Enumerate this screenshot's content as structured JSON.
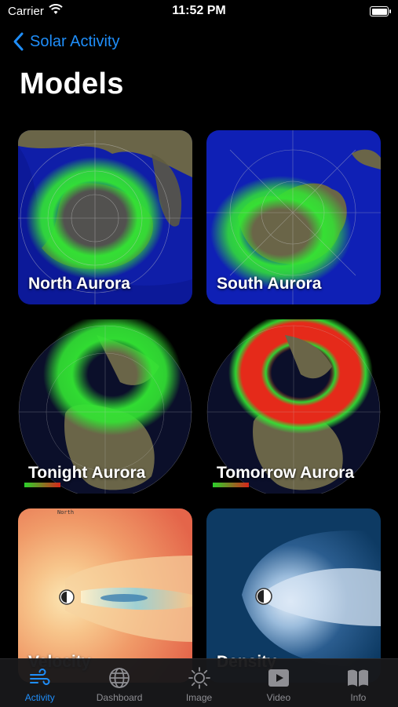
{
  "status": {
    "carrier": "Carrier",
    "time": "11:52 PM"
  },
  "nav": {
    "back_label": "Solar Activity",
    "title": "Models"
  },
  "tiles": [
    {
      "label": "North Aurora"
    },
    {
      "label": "South Aurora"
    },
    {
      "label": "Tonight Aurora"
    },
    {
      "label": "Tomorrow Aurora"
    },
    {
      "label": "Velocity"
    },
    {
      "label": "Density"
    }
  ],
  "chart_captions": {
    "velocity_panel": "North"
  },
  "tabs": [
    {
      "label": "Activity",
      "icon": "wind-icon",
      "active": true
    },
    {
      "label": "Dashboard",
      "icon": "globe-icon",
      "active": false
    },
    {
      "label": "Image",
      "icon": "sun-icon",
      "active": false
    },
    {
      "label": "Video",
      "icon": "play-icon",
      "active": false
    },
    {
      "label": "Info",
      "icon": "book-icon",
      "active": false
    }
  ],
  "colors": {
    "accent": "#1f8efa",
    "inactive": "#8e8e93",
    "aurora_green": "#33e633",
    "aurora_red": "#e52a1a"
  }
}
